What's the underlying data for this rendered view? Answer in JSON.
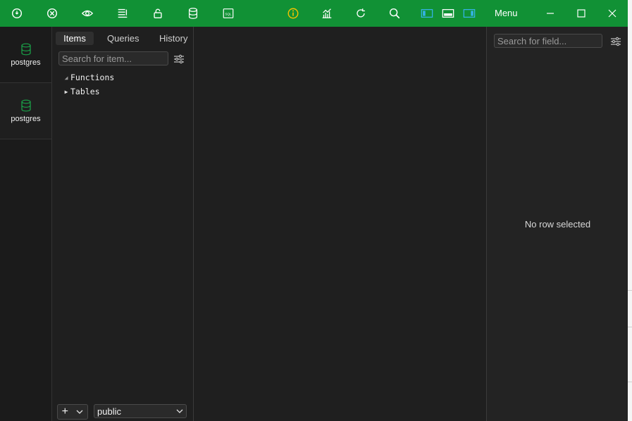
{
  "titlebar": {
    "toolbar_icons": [
      "connect-icon",
      "disconnect-icon",
      "preview-icon",
      "list-icon",
      "lock-icon",
      "database-icon",
      "sql-icon",
      "info-icon",
      "chart-icon",
      "refresh-icon",
      "search-icon",
      "left-panel-icon",
      "bottom-panel-icon",
      "right-panel-icon"
    ],
    "menu_label": "Menu",
    "accent_color": "#119135",
    "info_icon_color": "#f2c200",
    "layout_icon_color": "#35b3e6"
  },
  "connections": [
    {
      "label": "postgres",
      "icon": "database-icon",
      "icon_color": "#1aa64a"
    },
    {
      "label": "postgres",
      "icon": "database-icon",
      "icon_color": "#1aa64a"
    }
  ],
  "tree": {
    "tabs": [
      {
        "label": "Items",
        "active": true
      },
      {
        "label": "Queries",
        "active": false
      },
      {
        "label": "History",
        "active": false
      }
    ],
    "search_placeholder": "Search for item...",
    "nodes": [
      {
        "label": "Functions",
        "expanded": true
      },
      {
        "label": "Tables",
        "expanded": false
      }
    ],
    "add_label": "+",
    "schema": "public"
  },
  "detail": {
    "search_placeholder": "Search for field...",
    "empty_message": "No row selected"
  }
}
